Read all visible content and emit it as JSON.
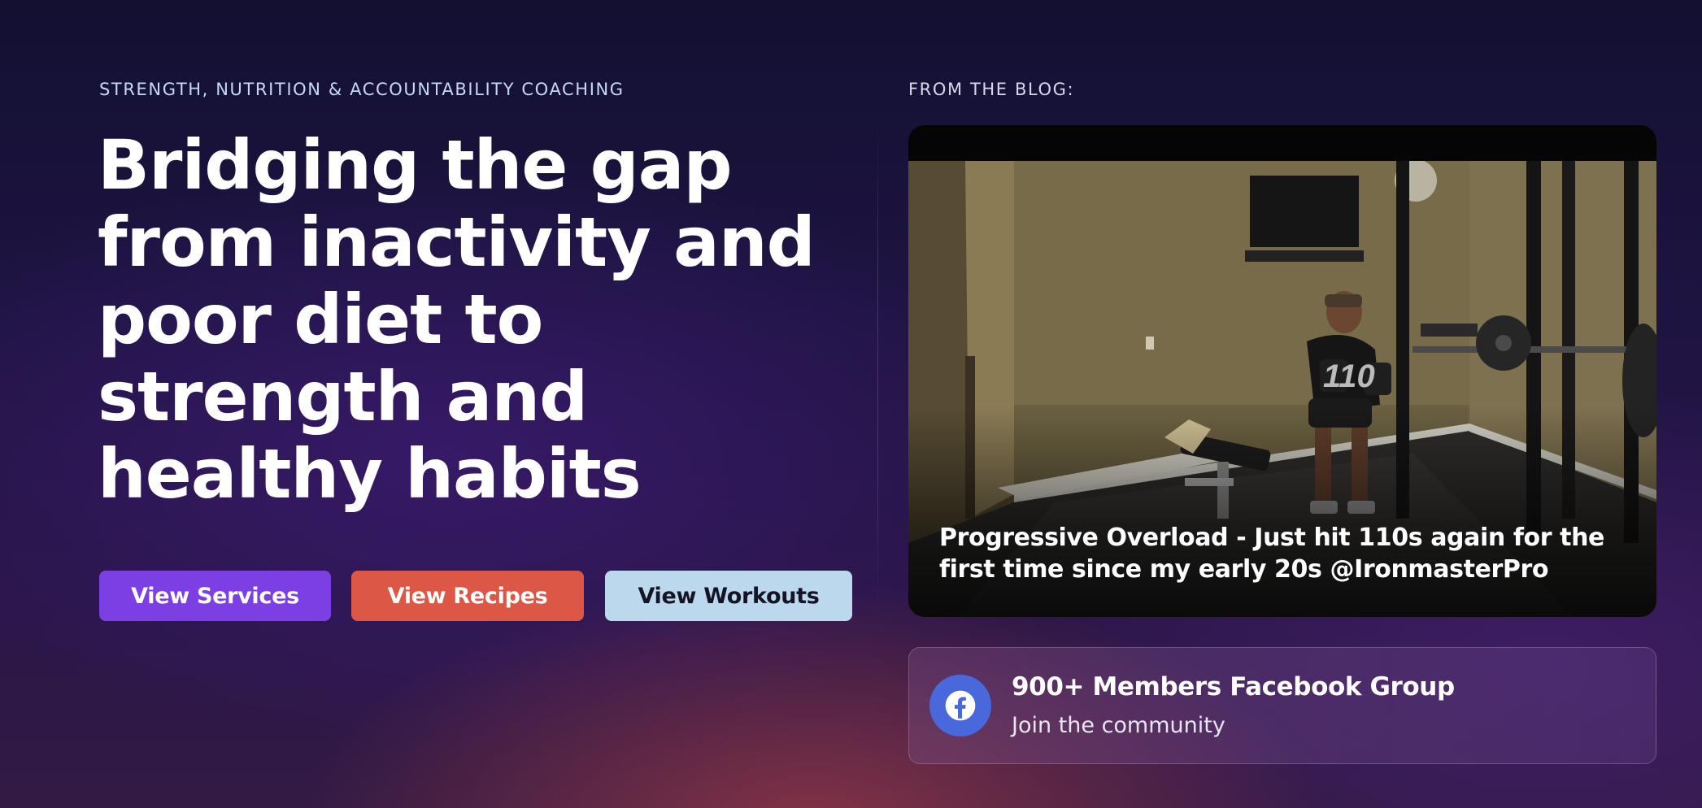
{
  "hero": {
    "eyebrow": "STRENGTH, NUTRITION & ACCOUNTABILITY COACHING",
    "headline_lines": [
      "Bridging the gap",
      "from inactivity and",
      "poor diet to",
      "strength and",
      "healthy habits"
    ],
    "buttons": {
      "services": "View Services",
      "recipes": "View Recipes",
      "workouts": "View Workouts"
    }
  },
  "blog": {
    "label": "FROM THE BLOG:",
    "post_caption": "Progressive Overload - Just hit 110s again for the first time since my early 20s @IronmasterPro",
    "photo_overlay_text": "110"
  },
  "community": {
    "title": "900+ Members Facebook Group",
    "subtitle": "Join the community",
    "icon": "facebook-icon"
  },
  "colors": {
    "services_button": "#7b3fe4",
    "recipes_button": "#dd5746",
    "workouts_button": "#bcd8ec",
    "facebook_blue": "#4968dc"
  }
}
